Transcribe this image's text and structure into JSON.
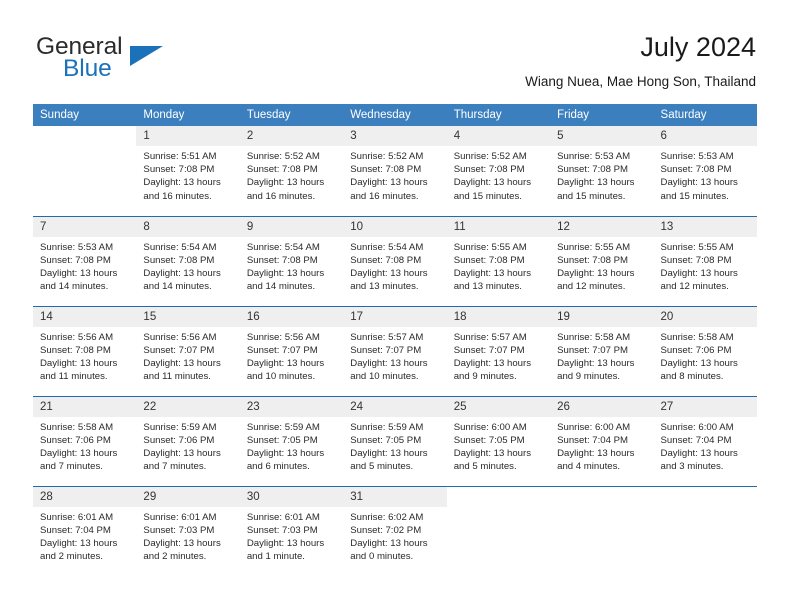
{
  "brand": {
    "name_part1": "General",
    "name_part2": "Blue",
    "accent_color": "#1b72bb",
    "logo_icon": "triangle-logo-icon"
  },
  "header": {
    "title": "July 2024",
    "subtitle": "Wiang Nuea, Mae Hong Son, Thailand"
  },
  "theme": {
    "header_band_color": "#3b7fbf",
    "row_divider_color": "#1f6bb0",
    "daynum_strip_color": "#efefef"
  },
  "weekdays": [
    "Sunday",
    "Monday",
    "Tuesday",
    "Wednesday",
    "Thursday",
    "Friday",
    "Saturday"
  ],
  "weeks": [
    [
      {
        "day": "",
        "sunrise": "",
        "sunset": "",
        "daylight": "",
        "empty": true
      },
      {
        "day": "1",
        "sunrise": "Sunrise: 5:51 AM",
        "sunset": "Sunset: 7:08 PM",
        "daylight": "Daylight: 13 hours and 16 minutes."
      },
      {
        "day": "2",
        "sunrise": "Sunrise: 5:52 AM",
        "sunset": "Sunset: 7:08 PM",
        "daylight": "Daylight: 13 hours and 16 minutes."
      },
      {
        "day": "3",
        "sunrise": "Sunrise: 5:52 AM",
        "sunset": "Sunset: 7:08 PM",
        "daylight": "Daylight: 13 hours and 16 minutes."
      },
      {
        "day": "4",
        "sunrise": "Sunrise: 5:52 AM",
        "sunset": "Sunset: 7:08 PM",
        "daylight": "Daylight: 13 hours and 15 minutes."
      },
      {
        "day": "5",
        "sunrise": "Sunrise: 5:53 AM",
        "sunset": "Sunset: 7:08 PM",
        "daylight": "Daylight: 13 hours and 15 minutes."
      },
      {
        "day": "6",
        "sunrise": "Sunrise: 5:53 AM",
        "sunset": "Sunset: 7:08 PM",
        "daylight": "Daylight: 13 hours and 15 minutes."
      }
    ],
    [
      {
        "day": "7",
        "sunrise": "Sunrise: 5:53 AM",
        "sunset": "Sunset: 7:08 PM",
        "daylight": "Daylight: 13 hours and 14 minutes."
      },
      {
        "day": "8",
        "sunrise": "Sunrise: 5:54 AM",
        "sunset": "Sunset: 7:08 PM",
        "daylight": "Daylight: 13 hours and 14 minutes."
      },
      {
        "day": "9",
        "sunrise": "Sunrise: 5:54 AM",
        "sunset": "Sunset: 7:08 PM",
        "daylight": "Daylight: 13 hours and 14 minutes."
      },
      {
        "day": "10",
        "sunrise": "Sunrise: 5:54 AM",
        "sunset": "Sunset: 7:08 PM",
        "daylight": "Daylight: 13 hours and 13 minutes."
      },
      {
        "day": "11",
        "sunrise": "Sunrise: 5:55 AM",
        "sunset": "Sunset: 7:08 PM",
        "daylight": "Daylight: 13 hours and 13 minutes."
      },
      {
        "day": "12",
        "sunrise": "Sunrise: 5:55 AM",
        "sunset": "Sunset: 7:08 PM",
        "daylight": "Daylight: 13 hours and 12 minutes."
      },
      {
        "day": "13",
        "sunrise": "Sunrise: 5:55 AM",
        "sunset": "Sunset: 7:08 PM",
        "daylight": "Daylight: 13 hours and 12 minutes."
      }
    ],
    [
      {
        "day": "14",
        "sunrise": "Sunrise: 5:56 AM",
        "sunset": "Sunset: 7:08 PM",
        "daylight": "Daylight: 13 hours and 11 minutes."
      },
      {
        "day": "15",
        "sunrise": "Sunrise: 5:56 AM",
        "sunset": "Sunset: 7:07 PM",
        "daylight": "Daylight: 13 hours and 11 minutes."
      },
      {
        "day": "16",
        "sunrise": "Sunrise: 5:56 AM",
        "sunset": "Sunset: 7:07 PM",
        "daylight": "Daylight: 13 hours and 10 minutes."
      },
      {
        "day": "17",
        "sunrise": "Sunrise: 5:57 AM",
        "sunset": "Sunset: 7:07 PM",
        "daylight": "Daylight: 13 hours and 10 minutes."
      },
      {
        "day": "18",
        "sunrise": "Sunrise: 5:57 AM",
        "sunset": "Sunset: 7:07 PM",
        "daylight": "Daylight: 13 hours and 9 minutes."
      },
      {
        "day": "19",
        "sunrise": "Sunrise: 5:58 AM",
        "sunset": "Sunset: 7:07 PM",
        "daylight": "Daylight: 13 hours and 9 minutes."
      },
      {
        "day": "20",
        "sunrise": "Sunrise: 5:58 AM",
        "sunset": "Sunset: 7:06 PM",
        "daylight": "Daylight: 13 hours and 8 minutes."
      }
    ],
    [
      {
        "day": "21",
        "sunrise": "Sunrise: 5:58 AM",
        "sunset": "Sunset: 7:06 PM",
        "daylight": "Daylight: 13 hours and 7 minutes."
      },
      {
        "day": "22",
        "sunrise": "Sunrise: 5:59 AM",
        "sunset": "Sunset: 7:06 PM",
        "daylight": "Daylight: 13 hours and 7 minutes."
      },
      {
        "day": "23",
        "sunrise": "Sunrise: 5:59 AM",
        "sunset": "Sunset: 7:05 PM",
        "daylight": "Daylight: 13 hours and 6 minutes."
      },
      {
        "day": "24",
        "sunrise": "Sunrise: 5:59 AM",
        "sunset": "Sunset: 7:05 PM",
        "daylight": "Daylight: 13 hours and 5 minutes."
      },
      {
        "day": "25",
        "sunrise": "Sunrise: 6:00 AM",
        "sunset": "Sunset: 7:05 PM",
        "daylight": "Daylight: 13 hours and 5 minutes."
      },
      {
        "day": "26",
        "sunrise": "Sunrise: 6:00 AM",
        "sunset": "Sunset: 7:04 PM",
        "daylight": "Daylight: 13 hours and 4 minutes."
      },
      {
        "day": "27",
        "sunrise": "Sunrise: 6:00 AM",
        "sunset": "Sunset: 7:04 PM",
        "daylight": "Daylight: 13 hours and 3 minutes."
      }
    ],
    [
      {
        "day": "28",
        "sunrise": "Sunrise: 6:01 AM",
        "sunset": "Sunset: 7:04 PM",
        "daylight": "Daylight: 13 hours and 2 minutes."
      },
      {
        "day": "29",
        "sunrise": "Sunrise: 6:01 AM",
        "sunset": "Sunset: 7:03 PM",
        "daylight": "Daylight: 13 hours and 2 minutes."
      },
      {
        "day": "30",
        "sunrise": "Sunrise: 6:01 AM",
        "sunset": "Sunset: 7:03 PM",
        "daylight": "Daylight: 13 hours and 1 minute."
      },
      {
        "day": "31",
        "sunrise": "Sunrise: 6:02 AM",
        "sunset": "Sunset: 7:02 PM",
        "daylight": "Daylight: 13 hours and 0 minutes."
      },
      {
        "day": "",
        "sunrise": "",
        "sunset": "",
        "daylight": "",
        "empty": true
      },
      {
        "day": "",
        "sunrise": "",
        "sunset": "",
        "daylight": "",
        "empty": true
      },
      {
        "day": "",
        "sunrise": "",
        "sunset": "",
        "daylight": "",
        "empty": true
      }
    ]
  ]
}
